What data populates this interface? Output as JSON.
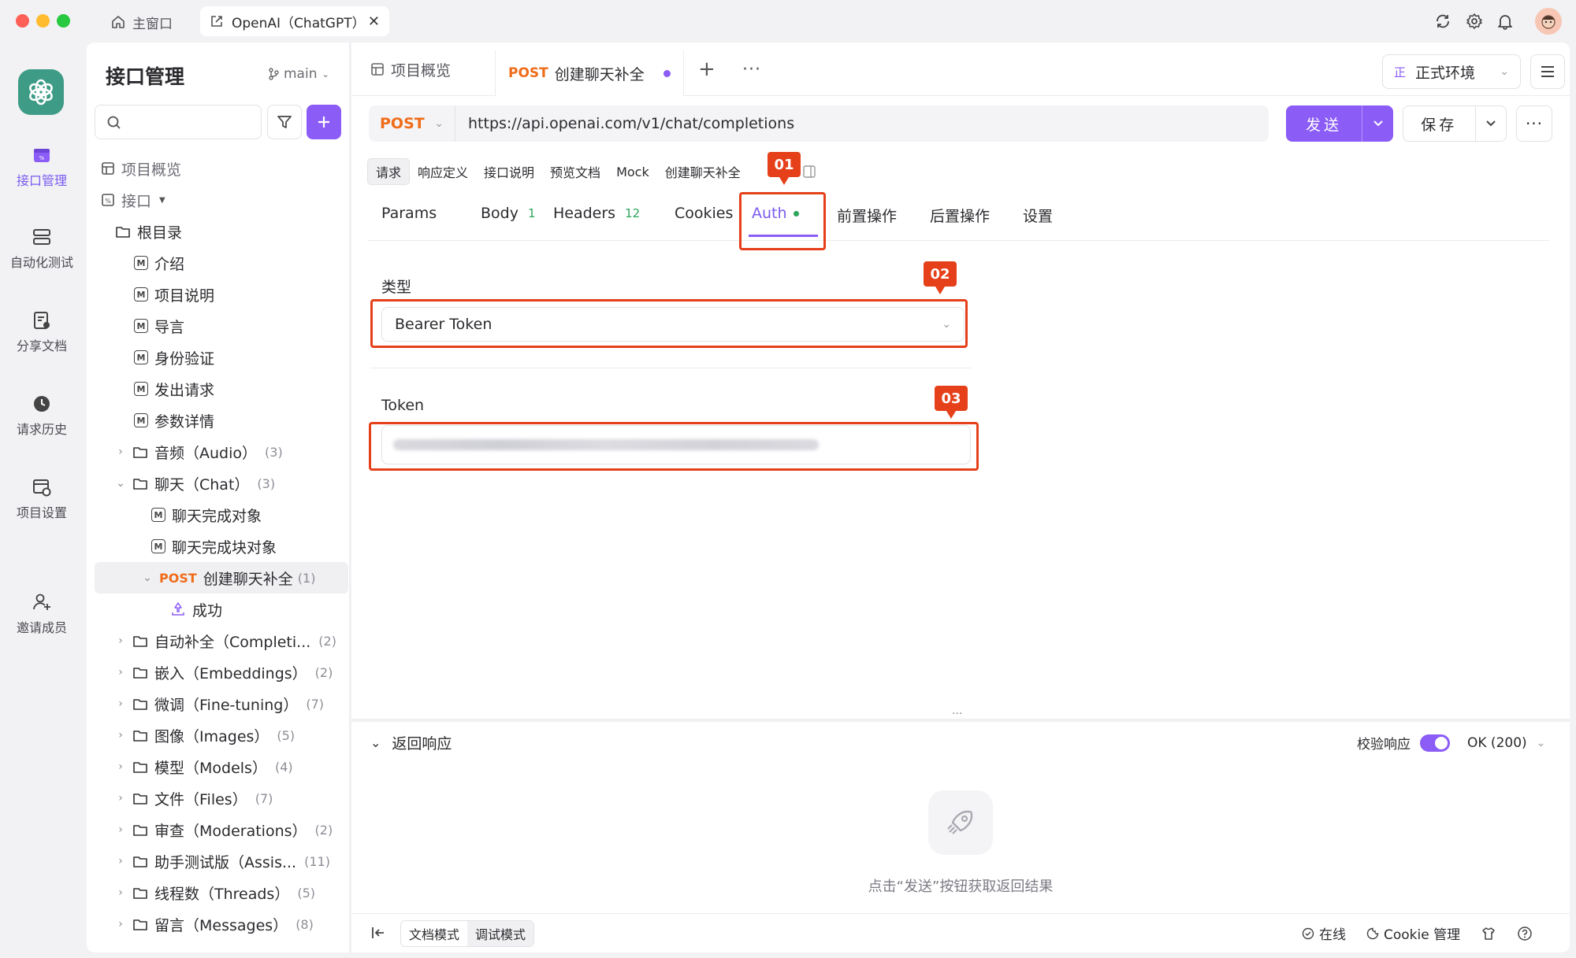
{
  "titlebar": {
    "home_tab": "主窗口",
    "active_tab": "OpenAI（ChatGPT）"
  },
  "rail": {
    "items": [
      {
        "label": "接口管理"
      },
      {
        "label": "自动化测试"
      },
      {
        "label": "分享文档"
      },
      {
        "label": "请求历史"
      },
      {
        "label": "项目设置"
      },
      {
        "label": "邀请成员"
      }
    ]
  },
  "sidebar": {
    "title": "接口管理",
    "branch": "main",
    "overview": "项目概览",
    "api_root": "接口",
    "tree": [
      {
        "label": "根目录"
      },
      {
        "label": "介绍"
      },
      {
        "label": "项目说明"
      },
      {
        "label": "导言"
      },
      {
        "label": "身份验证"
      },
      {
        "label": "发出请求"
      },
      {
        "label": "参数详情"
      },
      {
        "label": "音频（Audio）",
        "count": "(3)"
      },
      {
        "label": "聊天（Chat）",
        "count": "(3)"
      },
      {
        "label": "聊天完成对象"
      },
      {
        "label": "聊天完成块对象"
      },
      {
        "method": "POST",
        "label": "创建聊天补全",
        "count": "(1)"
      },
      {
        "label": "成功"
      },
      {
        "label": "自动补全（Completi...",
        "count": "(2)"
      },
      {
        "label": "嵌入（Embeddings）",
        "count": "(2)"
      },
      {
        "label": "微调（Fine-tuning）",
        "count": "(7)"
      },
      {
        "label": "图像（Images）",
        "count": "(5)"
      },
      {
        "label": "模型（Models）",
        "count": "(4)"
      },
      {
        "label": "文件（Files）",
        "count": "(7)"
      },
      {
        "label": "审查（Moderations）",
        "count": "(2)"
      },
      {
        "label": "助手测试版（Assis...",
        "count": "(11)"
      },
      {
        "label": "线程数（Threads）",
        "count": "(5)"
      },
      {
        "label": "留言（Messages）",
        "count": "(8)"
      }
    ]
  },
  "main": {
    "tabs": {
      "overview": "项目概览",
      "active_method": "POST",
      "active_label": "创建聊天补全"
    },
    "env": {
      "badge": "正",
      "label": "正式环境"
    },
    "request": {
      "method": "POST",
      "url": "https://api.openai.com/v1/chat/completions",
      "send_label": "发送",
      "save_label": "保存"
    },
    "subtabs": [
      "请求",
      "响应定义",
      "接口说明",
      "预览文档",
      "Mock",
      "创建聊天补全"
    ],
    "req_tabs": {
      "params": "Params",
      "body": "Body",
      "body_count": "1",
      "headers": "Headers",
      "headers_count": "12",
      "cookies": "Cookies",
      "auth": "Auth",
      "pre": "前置操作",
      "post": "后置操作",
      "settings": "设置"
    },
    "auth": {
      "type_label": "类型",
      "type_value": "Bearer Token",
      "token_label": "Token"
    },
    "annotations": [
      "01",
      "02",
      "03"
    ],
    "response": {
      "title": "返回响应",
      "validate_label": "校验响应",
      "status": "OK (200)",
      "hint": "点击“发送”按钮获取返回结果"
    },
    "footer": {
      "doc_mode": "文档模式",
      "debug_mode": "调试模式",
      "online": "在线",
      "cookie": "Cookie 管理"
    }
  },
  "colors": {
    "accent": "#8b5cf6",
    "post": "#ef6c1a",
    "annotation": "#e5401a",
    "logo": "#3e9c86"
  }
}
